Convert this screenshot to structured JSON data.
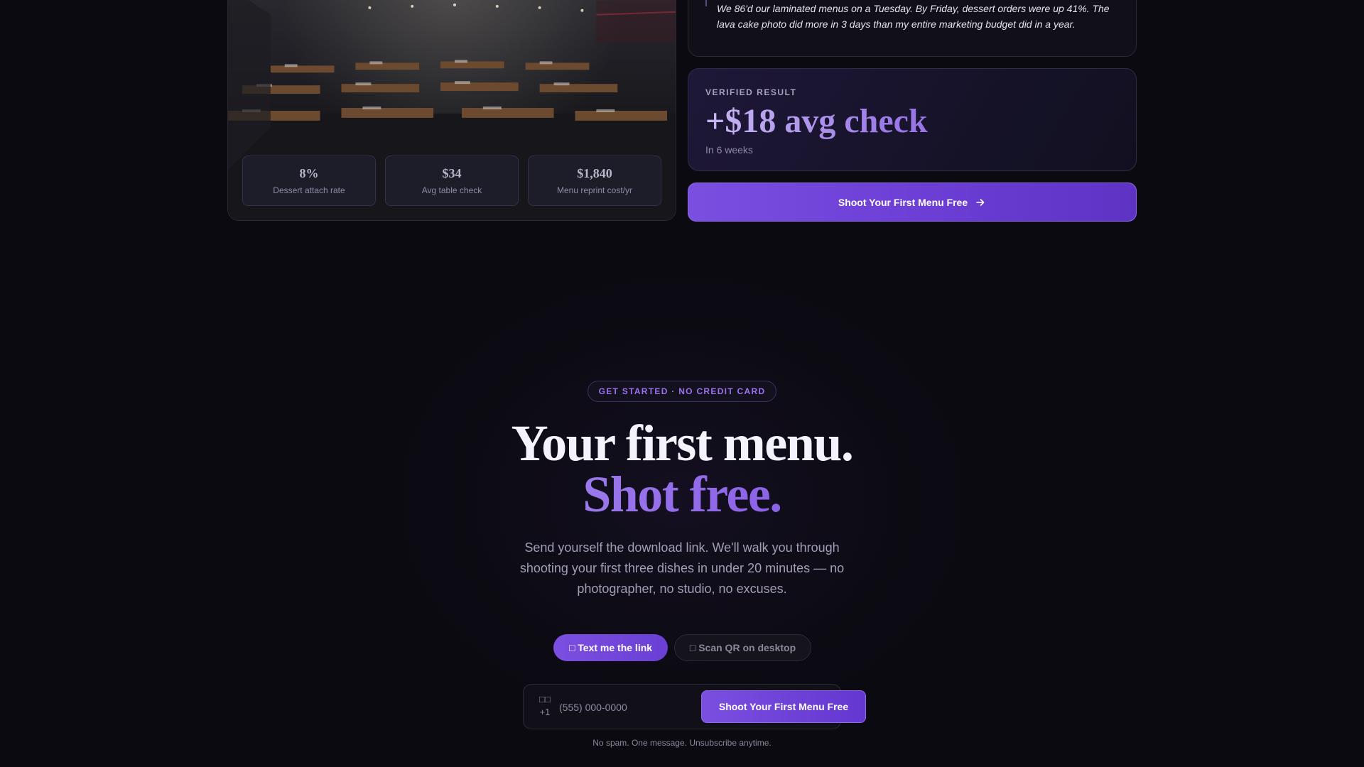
{
  "hero_card": {
    "stats": [
      {
        "value": "8%",
        "label": "Dessert attach rate"
      },
      {
        "value": "$34",
        "label": "Avg table check"
      },
      {
        "value": "$1,840",
        "label": "Menu reprint cost/yr"
      }
    ]
  },
  "testimonial": {
    "quote": "We 86'd our laminated menus on a Tuesday. By Friday, dessert orders were up 41%. The lava cake photo did more in 3 days than my entire marketing budget did in a year."
  },
  "result": {
    "label": "VERIFIED RESULT",
    "value": "+$18 avg check",
    "sub": "In 6 weeks"
  },
  "cta_top": {
    "label": "Shoot Your First Menu Free",
    "icon": "arrow-right-icon"
  },
  "signup": {
    "badge": "GET STARTED · NO CREDIT CARD",
    "headline_line1": "Your first menu.",
    "headline_line2": "Shot free.",
    "subcopy": "Send yourself the download link. We'll walk you through shooting your first three dishes in under 20 minutes — no photographer, no studio, no excuses.",
    "toggle_text": "□ Text me the link",
    "toggle_qr": "□ Scan QR on desktop",
    "country_flag": "□□",
    "country_code": "+1",
    "phone_placeholder": "(555) 000-0000",
    "submit_label": "Shoot Your First Menu Free",
    "disclaimer": "No spam. One message. Unsubscribe anytime."
  },
  "colors": {
    "accent": "#7b4fe0",
    "accent_light": "#9b72f0",
    "background": "#0b0a10"
  }
}
